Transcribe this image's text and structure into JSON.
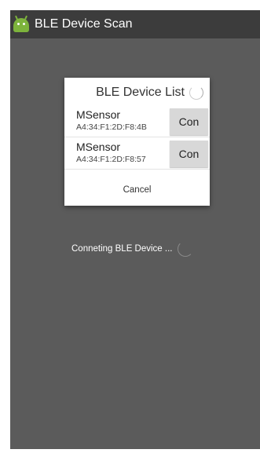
{
  "actionbar": {
    "title": "BLE Device Scan",
    "icon": "android-icon"
  },
  "dialog": {
    "title": "BLE Device List",
    "devices": [
      {
        "name": "MSensor",
        "address": "A4:34:F1:2D:F8:4B",
        "button_label": "Con"
      },
      {
        "name": "MSensor",
        "address": "A4:34:F1:2D:F8:57",
        "button_label": "Con"
      }
    ],
    "cancel_label": "Cancel"
  },
  "status": {
    "connecting_text": "Conneting BLE Device ..."
  },
  "colors": {
    "actionbar_bg": "#3c3c3c",
    "screen_dim": "#5b5b5b",
    "android_green": "#7db33c",
    "button_bg": "#d8d8d8"
  }
}
